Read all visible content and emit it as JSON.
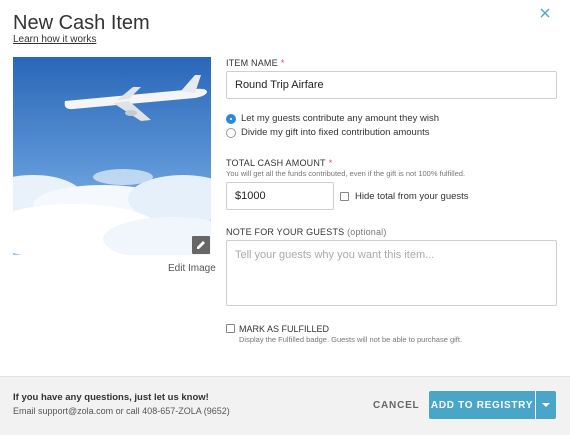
{
  "header": {
    "title": "New Cash Item",
    "learn_link": "Learn how it works"
  },
  "image": {
    "edit_label": "Edit Image"
  },
  "form": {
    "item_name": {
      "label": "ITEM NAME",
      "required_mark": "*",
      "value": "Round Trip Airfare"
    },
    "contribution": {
      "options": [
        {
          "label": "Let my guests contribute any amount they wish",
          "selected": true
        },
        {
          "label": "Divide my gift into fixed contribution amounts",
          "selected": false
        }
      ]
    },
    "total": {
      "label": "TOTAL CASH AMOUNT",
      "required_mark": "*",
      "help": "You will get all the funds contributed, even if the gift is not 100% fulfilled.",
      "value": "$1000",
      "hide_label": "Hide total from your guests",
      "hide_checked": false
    },
    "note": {
      "label": "NOTE FOR YOUR GUESTS",
      "optional": "(optional)",
      "placeholder": "Tell your guests why you want this item..."
    },
    "fulfilled": {
      "label": "MARK AS FULFILLED",
      "desc": "Display the Fulfilled badge. Guests will not be able to purchase gift.",
      "checked": false
    }
  },
  "footer": {
    "question": "If you have any questions, just let us know!",
    "contact": "Email support@zola.com or call 408-657-ZOLA (9652)",
    "cancel_label": "CANCEL",
    "add_label": "ADD TO REGISTRY"
  },
  "colors": {
    "accent": "#49a6c8",
    "radio_selected": "#2a8bd6",
    "required": "#d9534f"
  },
  "icons": [
    "close-icon",
    "pencil-icon",
    "chevron-down-icon"
  ]
}
